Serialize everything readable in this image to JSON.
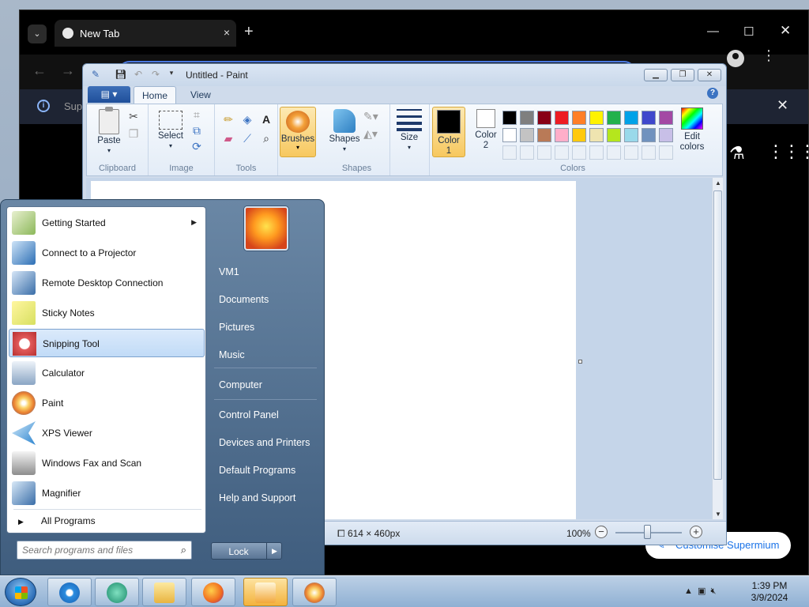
{
  "browser": {
    "tab_title": "New Tab",
    "close_tab": "×",
    "new_tab": "+",
    "infobar_text": "Sup",
    "customise_label": "Customise Supermium"
  },
  "paint": {
    "window_title": "Untitled - Paint",
    "tabs": [
      "Home",
      "View"
    ],
    "groups": {
      "clipboard": "Clipboard",
      "image": "Image",
      "tools": "Tools",
      "shapes": "Shapes",
      "colors": "Colors"
    },
    "buttons": {
      "paste": "Paste",
      "select": "Select",
      "brushes": "Brushes",
      "shapes": "Shapes",
      "size": "Size",
      "color1_line1": "Color",
      "color1_line2": "1",
      "color2_line1": "Color",
      "color2_line2": "2",
      "edit_colors_line1": "Edit",
      "edit_colors_line2": "colors"
    },
    "palette": [
      "#000000",
      "#7f7f7f",
      "#880015",
      "#ed1c24",
      "#ff7f27",
      "#fff200",
      "#22b14c",
      "#00a2e8",
      "#3f48cc",
      "#a349a4",
      "#ffffff",
      "#c3c3c3",
      "#b97a57",
      "#ffaec9",
      "#ffc90e",
      "#efe4b0",
      "#b5e61d",
      "#99d9ea",
      "#7092be",
      "#c8bfe7"
    ],
    "color1": "#000000",
    "color2": "#ffffff",
    "canvas_size": "614 × 460px",
    "zoom": "100%"
  },
  "start_menu": {
    "programs": [
      {
        "label": "Getting Started",
        "icon": "getting-started-icon",
        "submenu": true
      },
      {
        "label": "Connect to a Projector",
        "icon": "projector-icon"
      },
      {
        "label": "Remote Desktop Connection",
        "icon": "remote-desktop-icon"
      },
      {
        "label": "Sticky Notes",
        "icon": "sticky-notes-icon"
      },
      {
        "label": "Snipping Tool",
        "icon": "snipping-tool-icon",
        "hover": true
      },
      {
        "label": "Calculator",
        "icon": "calculator-icon"
      },
      {
        "label": "Paint",
        "icon": "paint-icon"
      },
      {
        "label": "XPS Viewer",
        "icon": "xps-viewer-icon"
      },
      {
        "label": "Windows Fax and Scan",
        "icon": "fax-scan-icon"
      },
      {
        "label": "Magnifier",
        "icon": "magnifier-icon"
      }
    ],
    "all_programs": "All Programs",
    "search_placeholder": "Search programs and files",
    "right_items": [
      "VM1",
      "Documents",
      "Pictures",
      "Music",
      "Computer",
      "Control Panel",
      "Devices and Printers",
      "Default Programs",
      "Help and Support"
    ],
    "lock_label": "Lock"
  },
  "taskbar": {
    "time": "1:39 PM",
    "date": "3/9/2024"
  }
}
